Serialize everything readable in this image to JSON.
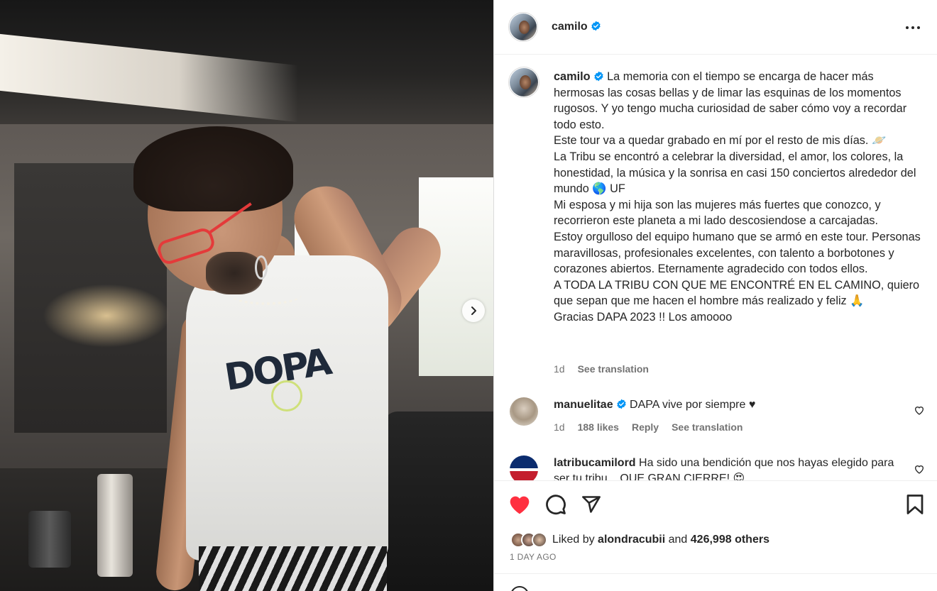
{
  "post": {
    "username": "camilo",
    "more_label": "More options"
  },
  "caption": {
    "username": "camilo",
    "lines": [
      "La memoria con el tiempo se encarga de hacer más hermosas las cosas bellas y de limar las esquinas de los momentos rugosos. Y yo tengo mucha curiosidad de saber cómo voy a recordar todo esto.",
      "Este tour va a quedar grabado en mí por el resto de mis días. 🪐",
      "La Tribu se encontró a celebrar la diversidad, el amor, los colores, la honestidad, la música y la sonrisa en casi 150 conciertos alrededor del mundo 🌎 UF",
      "Mi esposa y mi hija son las mujeres más fuertes que conozco, y recorrieron este planeta a mi lado descosiendose a carcajadas.",
      "Estoy orgulloso del equipo humano que se armó en este tour. Personas maravillosas, profesionales excelentes, con talento a borbotones y corazones abiertos. Eternamente agradecido con todos ellos.",
      "A TODA LA TRIBU CON QUE ME ENCONTRÉ EN EL CAMINO, quiero que sepan que me hacen el hombre más realizado y feliz 🙏",
      "Gracias DAPA 2023 !! Los amoooo"
    ],
    "time": "1d",
    "see_translation": "See translation"
  },
  "comments": [
    {
      "username": "manuelitae",
      "verified": true,
      "text": "DAPA vive por siempre ♥",
      "time": "1d",
      "likes": "188 likes",
      "reply": "Reply",
      "see_translation": "See translation"
    },
    {
      "username": "latribucamilord",
      "verified": false,
      "text": "Ha sido una bendición que nos hayas elegido para ser tu tribu... QUE GRAN CIERRE! 😍"
    }
  ],
  "photo": {
    "shirt_text": "DOPA"
  },
  "likes": {
    "prefix": "Liked by",
    "user": "alondracubii",
    "and": "and",
    "others": "426,998 others"
  },
  "date": "1 DAY AGO",
  "colors": {
    "like_red": "#ff3040",
    "verified_blue": "#0095f6",
    "text": "#262626",
    "muted": "#737373"
  },
  "icons": {
    "like": "heart-icon",
    "comment": "comment-icon",
    "share": "send-icon",
    "save": "bookmark-icon",
    "next": "chevron-right-icon",
    "more": "more-icon",
    "verified": "verified-badge-icon"
  }
}
